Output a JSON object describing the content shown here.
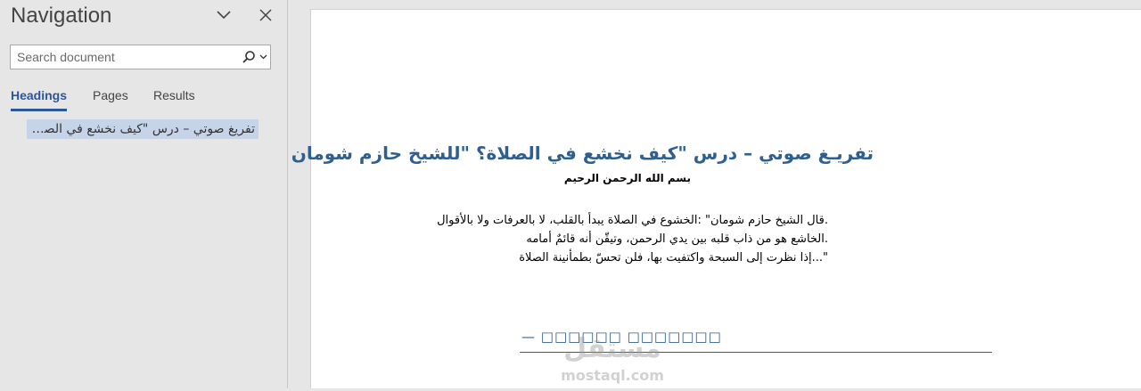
{
  "navigation": {
    "title": "Navigation",
    "search_placeholder": "Search document",
    "tabs": [
      {
        "label": "Headings",
        "active": true
      },
      {
        "label": "Pages",
        "active": false
      },
      {
        "label": "Results",
        "active": false
      }
    ],
    "headings": [
      {
        "label": "تفريغ صوتي – درس \"كيف نخشع في الصلاة؟ \"للشيخ حازم شومان"
      }
    ]
  },
  "document": {
    "heading": "تفريـغ صوتي – درس \"كيف نخشع في الصلاة؟ \"للشيخ حازم شومان",
    "subtitle": "بسم الله الرحمن الرحيم",
    "paragraph_lines": [
      ".قال الشيخ حازم شومان\" :الخشوع في الصلاة يبدأ بالقلب، لا بالعرفات ولا بالأقوال",
      ".الخاشع هو من ذاب قلبه بين يدي الرحمن، وتيقّن أنه قائمٌ أمامه",
      "\"...إذا نظرت إلى السبحة واكتفيت بها، فلن تحسّ بطمأنينة الصلاة"
    ],
    "footer_text": "— □□□□□□ □□□□□□□",
    "watermark": {
      "arabic": "مستقل",
      "latin": "mostaql.com"
    }
  },
  "colors": {
    "accent": "#2b579a",
    "heading": "#2e5f8e",
    "selection": "#c6d4ea",
    "pane_bg": "#e6e6e6"
  },
  "icons": {
    "options": "chevron-down-icon",
    "close": "close-icon",
    "search": "search-icon",
    "search_dropdown": "caret-down-icon"
  }
}
